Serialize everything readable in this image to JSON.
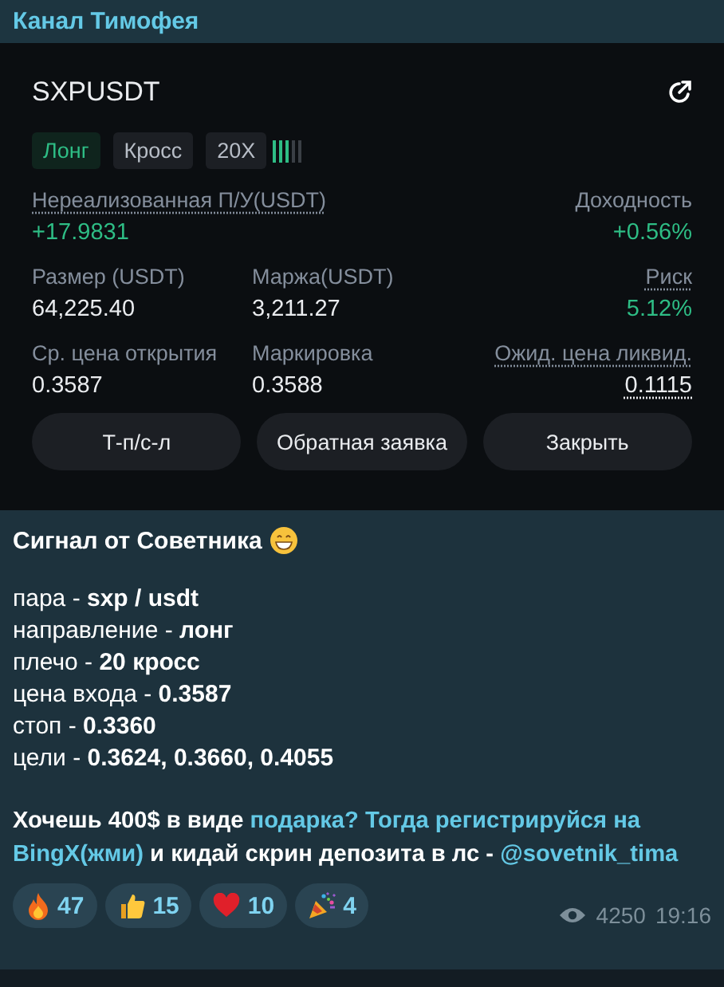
{
  "header": {
    "title": "Канал Тимофея"
  },
  "position": {
    "symbol": "SXPUSDT",
    "tags": [
      {
        "label": "Лонг",
        "kind": "direction"
      },
      {
        "label": "Кросс",
        "kind": "plain"
      },
      {
        "label": "20X",
        "kind": "plain"
      }
    ],
    "leverage": {
      "level": 0.6
    },
    "stats": [
      [
        {
          "label": "Нереализованная П/У(USDT)",
          "value": "+17.9831",
          "dotted": true,
          "positive": true
        },
        {
          "label": "Доходность",
          "value": "+0.56%",
          "dotted": false,
          "positive": true
        }
      ],
      [
        {
          "label": "Размер (USDT)",
          "value": "64,225.40",
          "dotted": false,
          "positive": false
        },
        {
          "label": "Маржа(USDT)",
          "value": "3,211.27",
          "dotted": false,
          "positive": false
        },
        {
          "label": "Риск",
          "value": "5.12%",
          "dotted": true,
          "positive": true
        }
      ],
      [
        {
          "label": "Ср. цена открытия",
          "value": "0.3587",
          "dotted": false,
          "positive": false
        },
        {
          "label": "Маркировка",
          "value": "0.3588",
          "dotted": false,
          "positive": false
        },
        {
          "label": "Ожид. цена ликвид.",
          "value": "0.1115",
          "dotted": true,
          "value_dotted": true,
          "positive": false
        }
      ]
    ],
    "buttons": [
      "Т-п/с-л",
      "Обратная заявка",
      "Закрыть"
    ]
  },
  "message": {
    "title": "Сигнал от Советника",
    "lines": [
      "пара - **sxp / usdt**",
      "направление - **лонг**",
      "плечо - **20 кросс**",
      "цена входа - **0.3587**",
      "стоп - **0.3360**",
      "цели - **0.3624, 0.3660, 0.4055**"
    ],
    "promo": [
      {
        "text": "Хочешь 400$ в виде ",
        "link": false
      },
      {
        "text": "подарка? Тогда регистрируйся на",
        "link": true
      },
      {
        "text": "BingX(жми)",
        "link": true
      },
      {
        "text": " и кидай скрин депозита в лс - ",
        "link": false
      },
      {
        "text": "@sovetnik_tima",
        "link": true
      }
    ],
    "reactions": [
      {
        "kind": "fire",
        "count": "47"
      },
      {
        "kind": "thumb",
        "count": "15"
      },
      {
        "kind": "heart",
        "count": "10"
      },
      {
        "kind": "party",
        "count": "4"
      }
    ],
    "views": "4250",
    "time": "19:16"
  }
}
